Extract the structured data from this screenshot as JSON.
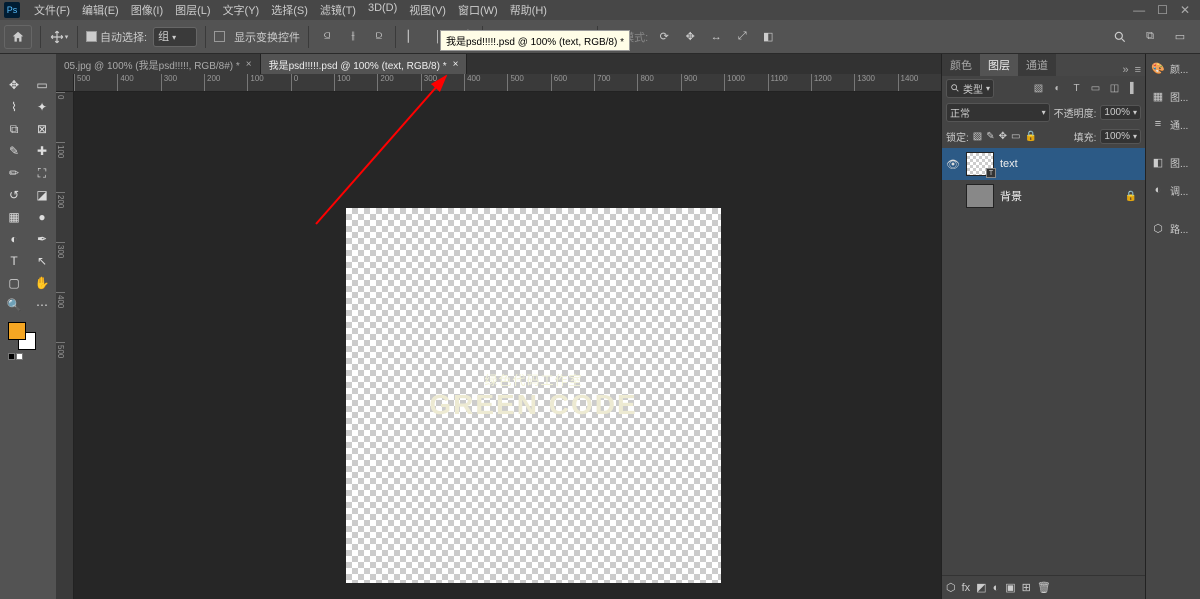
{
  "menu": {
    "items": [
      "文件(F)",
      "编辑(E)",
      "图像(I)",
      "图层(L)",
      "文字(Y)",
      "选择(S)",
      "滤镜(T)",
      "3D(D)",
      "视图(V)",
      "窗口(W)",
      "帮助(H)"
    ]
  },
  "options": {
    "auto_select_checkbox": "自动选择:",
    "auto_select_mode": "组",
    "show_transform_controls": "显示变换控件",
    "more": "•••",
    "mode3d": "3D 模式:"
  },
  "tooltip": "我是psd!!!!!.psd @ 100% (text, RGB/8) *",
  "tabs": [
    {
      "label": "05.jpg @ 100% (我是psd!!!!!, RGB/8#) *",
      "active": false
    },
    {
      "label": "我是psd!!!!!.psd @ 100% (text, RGB/8) *",
      "active": true
    }
  ],
  "ruler_h": [
    "500",
    "400",
    "300",
    "200",
    "100",
    "0",
    "100",
    "200",
    "300",
    "400",
    "500",
    "600",
    "700",
    "800",
    "900",
    "1000",
    "1100",
    "1200",
    "1300",
    "1400"
  ],
  "ruler_v": [
    "0",
    "100",
    "200",
    "300",
    "400",
    "500"
  ],
  "artboard": {
    "line1": "绿色代码工作室",
    "line2": "GREEN CODE"
  },
  "panels": {
    "header_tabs": [
      "颜色",
      "图层",
      "通道"
    ],
    "active_tab": 1,
    "filter_label": "类型",
    "blend_mode": "正常",
    "opacity_label": "不透明度:",
    "opacity_value": "100%",
    "lock_label": "锁定:",
    "fill_label": "填充:",
    "fill_value": "100%",
    "layers": [
      {
        "name": "text",
        "selected": true,
        "visible": true,
        "thumb": "checker",
        "locked": false
      },
      {
        "name": "背景",
        "selected": false,
        "visible": false,
        "thumb": "solid",
        "locked": true
      }
    ]
  },
  "right_dock": [
    "颜...",
    "图...",
    "通...",
    "",
    "图...",
    "调...",
    "",
    "路..."
  ],
  "swatches": {
    "fg": "#f5a623",
    "bg": "#ffffff"
  }
}
